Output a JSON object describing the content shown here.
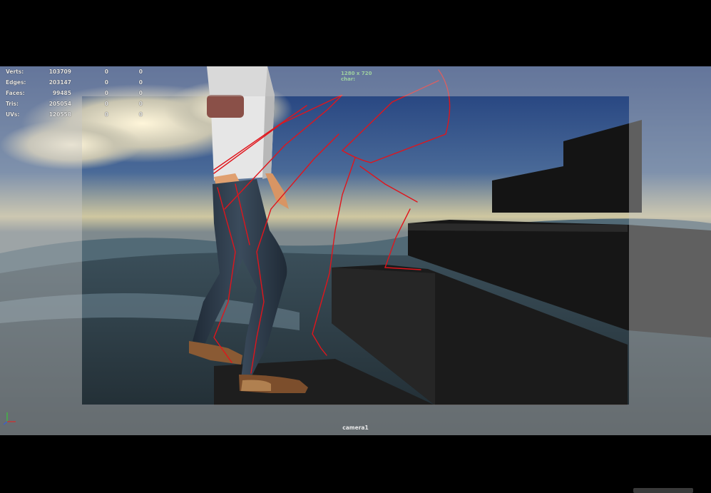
{
  "hud": {
    "rows": [
      {
        "label": "Verts:",
        "v1": "103709",
        "v2": "0",
        "v3": "0"
      },
      {
        "label": "Edges:",
        "v1": "203147",
        "v2": "0",
        "v3": "0"
      },
      {
        "label": "Faces:",
        "v1": "99485",
        "v2": "0",
        "v3": "0"
      },
      {
        "label": "Tris:",
        "v1": "205054",
        "v2": "0",
        "v3": "0"
      },
      {
        "label": "UVs:",
        "v1": "120558",
        "v2": "0",
        "v3": "0"
      }
    ]
  },
  "resolution_gate": {
    "size": "1280 x 720",
    "camera_tag": "char:"
  },
  "camera_name": "camera1",
  "colors": {
    "sketch": "#e0151c",
    "sky_top": "#1c3a7a",
    "horizon": "#cfc7a0",
    "shirt": "#e8e8e8",
    "jeans": "#2e3c4a",
    "skin": "#e0a070",
    "shoes": "#7a5030",
    "block": "#1e1e1e"
  },
  "icons": {
    "axis": "axis-gizmo-icon"
  }
}
